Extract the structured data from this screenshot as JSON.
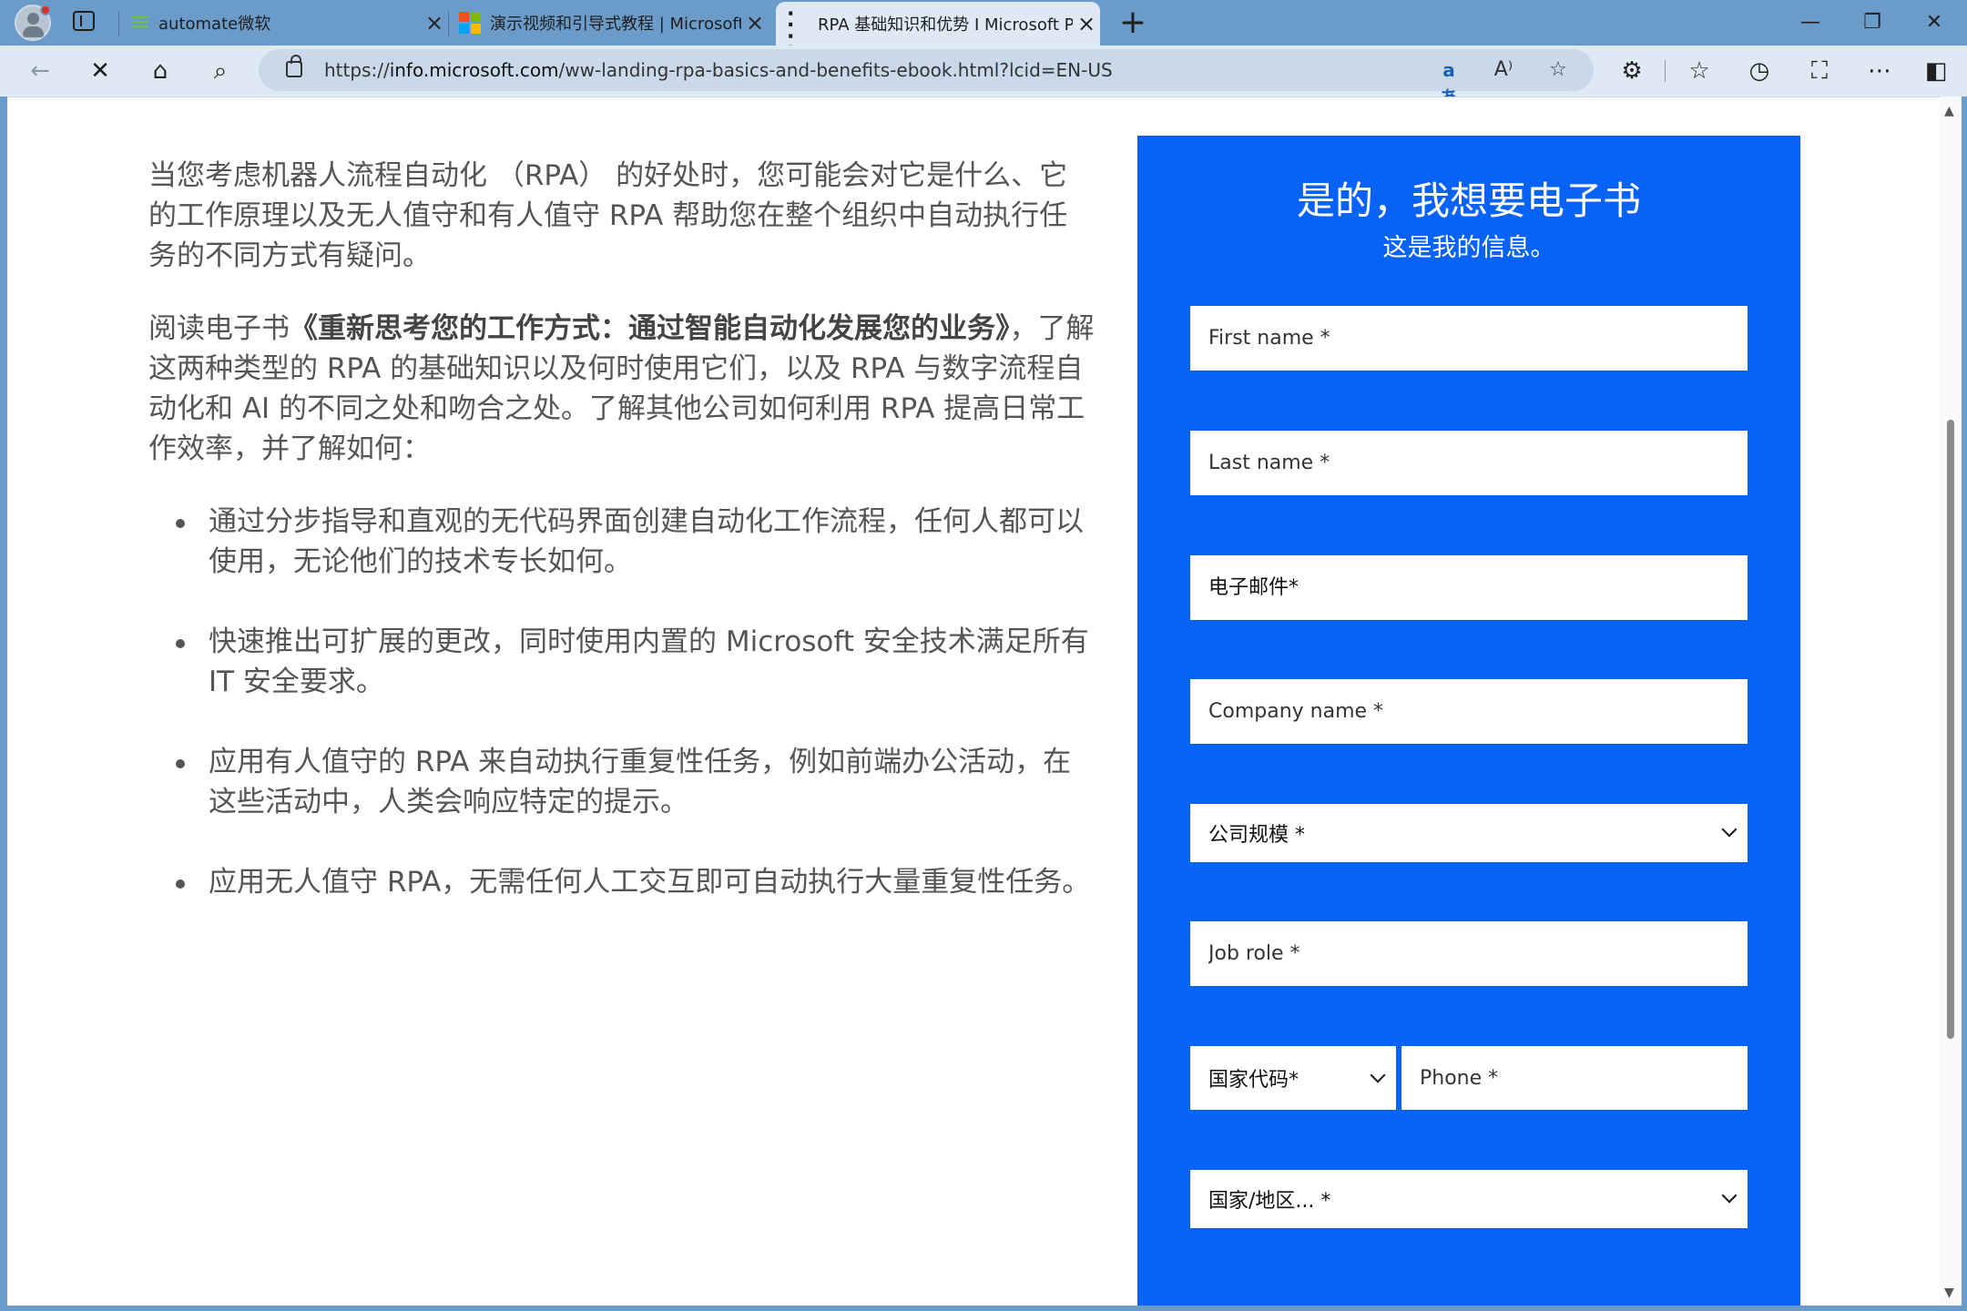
{
  "browser": {
    "tabs": [
      {
        "title": "automate微软",
        "favicon": "power-automate-icon"
      },
      {
        "title": "演示视频和引导式教程 | Microsoft",
        "favicon": "microsoft-logo-icon"
      },
      {
        "title": "RPA 基础知识和优势 I Microsoft P",
        "favicon": "loading-icon"
      }
    ],
    "url_prefix": "https://",
    "url_host": "info.microsoft.com",
    "url_path": "/ww-landing-rpa-basics-and-benefits-ebook.html?lcid=EN-US"
  },
  "article": {
    "para1": "当您考虑机器人流程自动化 （RPA） 的好处时，您可能会对它是什么、它的工作原理以及无人值守和有人值守 RPA 帮助您在整个组织中自动执行任务的不同方式有疑问。",
    "para2_before": "阅读电子书",
    "para2_bold": "《重新思考您的工作方式：通过智能自动化发展您的业务》",
    "para2_after": "，了解这两种类型的 RPA 的基础知识以及何时使用它们，以及 RPA 与数字流程自动化和 AI 的不同之处和吻合之处。了解其他公司如何利用 RPA 提高日常工作效率，并了解如何：",
    "bullets": [
      "通过分步指导和直观的无代码界面创建自动化工作流程，任何人都可以使用，无论他们的技术专长如何。",
      "快速推出可扩展的更改，同时使用内置的 Microsoft 安全技术满足所有 IT 安全要求。",
      "应用有人值守的 RPA 来自动执行重复性任务，例如前端办公活动，在这些活动中，人类会响应特定的提示。",
      "应用无人值守 RPA，无需任何人工交互即可自动执行大量重复性任务。"
    ]
  },
  "form": {
    "title": "是的，我想要电子书",
    "subtitle": "这是我的信息。",
    "first_name": "First name *",
    "last_name": "Last name *",
    "email": "电子邮件*",
    "company_name": "Company name *",
    "company_size": "公司规模 *",
    "job_role": "Job role *",
    "country_code": "国家代码*",
    "phone": "Phone *",
    "country": "国家/地区... *"
  }
}
